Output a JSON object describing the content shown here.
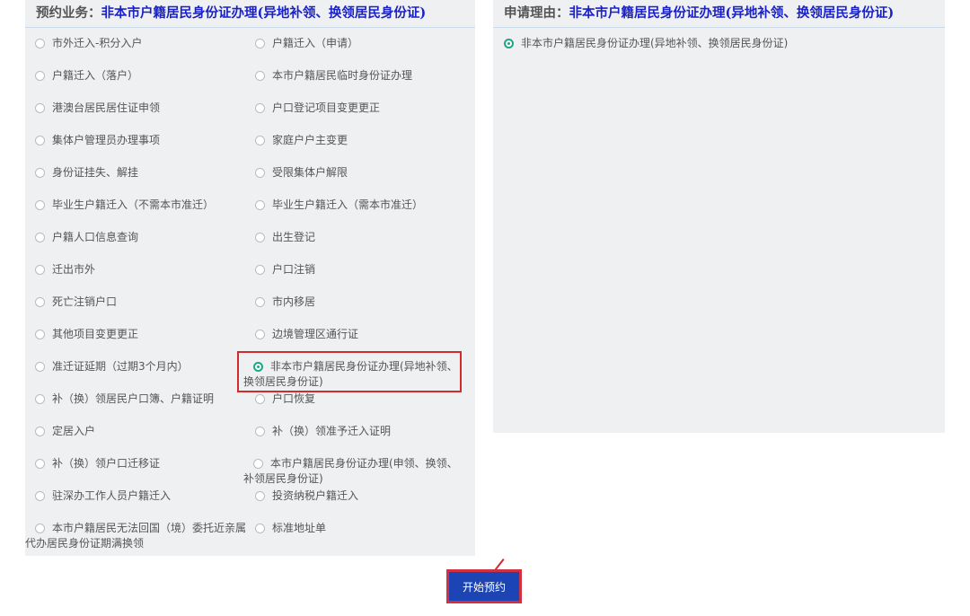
{
  "left_panel": {
    "label": "预约业务：",
    "value": "非本市户籍居民身份证办理(异地补领、换领居民身份证)"
  },
  "right_panel": {
    "label": "申请理由：",
    "value": "非本市户籍居民身份证办理(异地补领、换领居民身份证)",
    "options": [
      {
        "label": "非本市户籍居民身份证办理(异地补领、换领居民身份证)",
        "selected": true
      }
    ]
  },
  "options": [
    {
      "label": "市外迁入-积分入户",
      "selected": false
    },
    {
      "label": "户籍迁入（申请）",
      "selected": false
    },
    {
      "label": "户籍迁入（落户）",
      "selected": false
    },
    {
      "label": "本市户籍居民临时身份证办理",
      "selected": false
    },
    {
      "label": "港澳台居民居住证申领",
      "selected": false
    },
    {
      "label": "户口登记项目变更更正",
      "selected": false
    },
    {
      "label": "集体户管理员办理事项",
      "selected": false
    },
    {
      "label": "家庭户户主变更",
      "selected": false
    },
    {
      "label": "身份证挂失、解挂",
      "selected": false
    },
    {
      "label": "受限集体户解限",
      "selected": false
    },
    {
      "label": "毕业生户籍迁入（不需本市准迁）",
      "selected": false
    },
    {
      "label": "毕业生户籍迁入（需本市准迁）",
      "selected": false
    },
    {
      "label": "户籍人口信息查询",
      "selected": false
    },
    {
      "label": "出生登记",
      "selected": false
    },
    {
      "label": "迁出市外",
      "selected": false
    },
    {
      "label": "户口注销",
      "selected": false
    },
    {
      "label": "死亡注销户口",
      "selected": false
    },
    {
      "label": "市内移居",
      "selected": false
    },
    {
      "label": "其他项目变更更正",
      "selected": false
    },
    {
      "label": "边境管理区通行证",
      "selected": false
    },
    {
      "label": "准迁证延期（过期3个月内）",
      "selected": false
    },
    {
      "label": "非本市户籍居民身份证办理(异地补领、换领居民身份证)",
      "selected": true
    },
    {
      "label": "补（换）领居民户口簿、户籍证明",
      "selected": false
    },
    {
      "label": "户口恢复",
      "selected": false
    },
    {
      "label": "定居入户",
      "selected": false
    },
    {
      "label": "补（换）领准予迁入证明",
      "selected": false
    },
    {
      "label": "补（换）领户口迁移证",
      "selected": false
    },
    {
      "label": "本市户籍居民身份证办理(申领、换领、补领居民身份证)",
      "selected": false
    },
    {
      "label": "驻深办工作人员户籍迁入",
      "selected": false
    },
    {
      "label": "投资纳税户籍迁入",
      "selected": false
    },
    {
      "label": "本市户籍居民无法回国（境）委托近亲属代办居民身份证期满换领",
      "selected": false
    },
    {
      "label": "标准地址单",
      "selected": false
    }
  ],
  "start_button": {
    "label": "开始预约"
  },
  "colors": {
    "accent_text": "#1a21c8",
    "panel_bg": "#eef0f2",
    "radio_checked": "#19a88a",
    "button_bg": "#1c44b5",
    "highlight_border": "#d42a2a"
  }
}
